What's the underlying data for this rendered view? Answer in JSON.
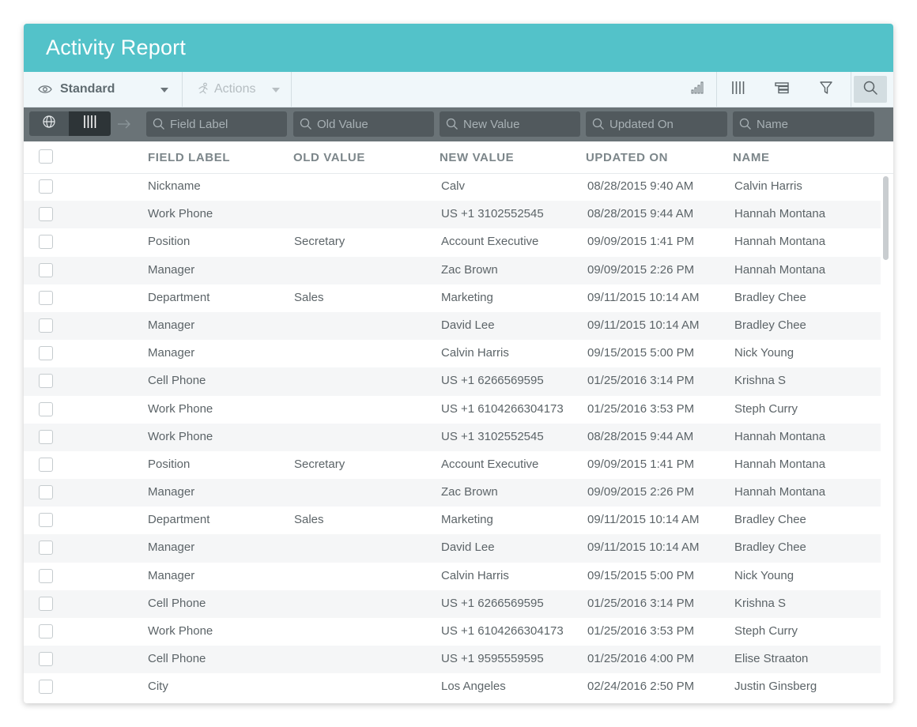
{
  "title": "Activity Report",
  "toolbar": {
    "view_label": "Standard",
    "actions_label": "Actions",
    "icons": [
      "chart-icon",
      "columns-icon",
      "group-icon",
      "filter-icon",
      "search-icon"
    ]
  },
  "filters": {
    "field_label": "Field Label",
    "old_value": "Old Value",
    "new_value": "New Value",
    "updated_on": "Updated On",
    "name": "Name"
  },
  "columns": [
    "FIELD LABEL",
    "OLD VALUE",
    "NEW VALUE",
    "UPDATED ON",
    "NAME"
  ],
  "rows": [
    {
      "field": "Nickname",
      "old": "",
      "new": "Calv",
      "updated": "08/28/2015 9:40 AM",
      "name": "Calvin Harris"
    },
    {
      "field": "Work Phone",
      "old": "",
      "new": "US +1 3102552545",
      "updated": "08/28/2015 9:44 AM",
      "name": "Hannah Montana"
    },
    {
      "field": "Position",
      "old": "Secretary",
      "new": "Account Executive",
      "updated": "09/09/2015 1:41 PM",
      "name": "Hannah Montana"
    },
    {
      "field": "Manager",
      "old": "",
      "new": "Zac Brown",
      "updated": "09/09/2015 2:26 PM",
      "name": "Hannah Montana"
    },
    {
      "field": "Department",
      "old": "Sales",
      "new": "Marketing",
      "updated": "09/11/2015 10:14 AM",
      "name": "Bradley Chee"
    },
    {
      "field": "Manager",
      "old": "",
      "new": "David Lee",
      "updated": "09/11/2015 10:14 AM",
      "name": "Bradley Chee"
    },
    {
      "field": "Manager",
      "old": "",
      "new": "Calvin Harris",
      "updated": "09/15/2015 5:00 PM",
      "name": "Nick Young"
    },
    {
      "field": "Cell Phone",
      "old": "",
      "new": "US +1 6266569595",
      "updated": "01/25/2016 3:14 PM",
      "name": "Krishna S"
    },
    {
      "field": "Work Phone",
      "old": "",
      "new": "US +1 6104266304173",
      "updated": "01/25/2016 3:53 PM",
      "name": "Steph Curry"
    },
    {
      "field": "Work Phone",
      "old": "",
      "new": "US +1 3102552545",
      "updated": "08/28/2015 9:44 AM",
      "name": "Hannah Montana"
    },
    {
      "field": "Position",
      "old": "Secretary",
      "new": "Account Executive",
      "updated": "09/09/2015 1:41 PM",
      "name": "Hannah Montana"
    },
    {
      "field": "Manager",
      "old": "",
      "new": "Zac Brown",
      "updated": "09/09/2015 2:26 PM",
      "name": "Hannah Montana"
    },
    {
      "field": "Department",
      "old": "Sales",
      "new": "Marketing",
      "updated": "09/11/2015 10:14 AM",
      "name": "Bradley Chee"
    },
    {
      "field": "Manager",
      "old": "",
      "new": "David Lee",
      "updated": "09/11/2015 10:14 AM",
      "name": "Bradley Chee"
    },
    {
      "field": "Manager",
      "old": "",
      "new": "Calvin Harris",
      "updated": "09/15/2015 5:00 PM",
      "name": "Nick Young"
    },
    {
      "field": "Cell Phone",
      "old": "",
      "new": "US +1 6266569595",
      "updated": "01/25/2016 3:14 PM",
      "name": "Krishna S"
    },
    {
      "field": "Work Phone",
      "old": "",
      "new": "US +1 6104266304173",
      "updated": "01/25/2016 3:53 PM",
      "name": "Steph Curry"
    },
    {
      "field": "Cell Phone",
      "old": "",
      "new": "US +1 9595559595",
      "updated": "01/25/2016 4:00 PM",
      "name": "Elise Straaton"
    },
    {
      "field": "City",
      "old": "",
      "new": "Los Angeles",
      "updated": "02/24/2016 2:50 PM",
      "name": "Justin Ginsberg"
    }
  ],
  "colors": {
    "header_bg": "#53c2c9",
    "toolbar_bg": "#f0f7fa",
    "filter_bar_bg": "#6a7377",
    "row_alt_bg": "#f5f6f7"
  }
}
